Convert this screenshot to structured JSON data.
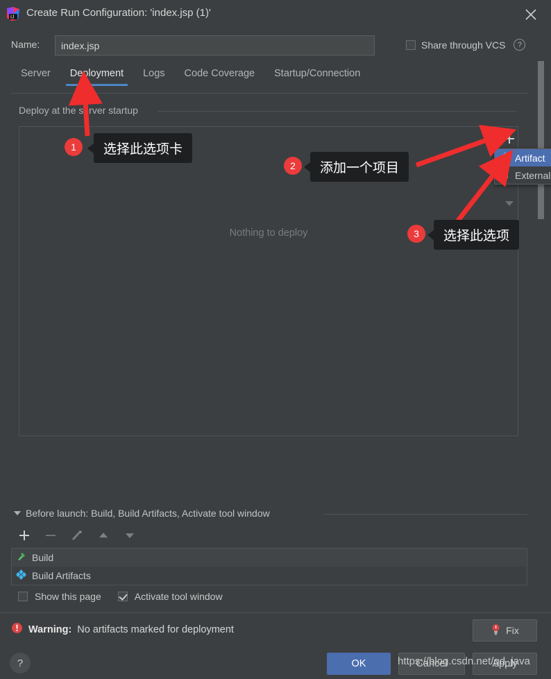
{
  "window": {
    "title": "Create Run Configuration: 'index.jsp (1)'",
    "app_icon": "intellij-idea-logo",
    "close_icon": "close-icon"
  },
  "name_row": {
    "label": "Name:",
    "value": "index.jsp",
    "placeholder": "",
    "share_vcs_label": "Share through VCS",
    "share_vcs_checked": false,
    "help_icon": "question-mark-icon"
  },
  "tabs": [
    {
      "label": "Server",
      "active": false
    },
    {
      "label": "Deployment",
      "active": true
    },
    {
      "label": "Logs",
      "active": false
    },
    {
      "label": "Code Coverage",
      "active": false
    },
    {
      "label": "Startup/Connection",
      "active": false
    }
  ],
  "deployment": {
    "group_title": "Deploy at the server startup",
    "empty_text": "Nothing to deploy",
    "add_icon": "plus-icon",
    "dropdown_icon": "chevron-down-icon"
  },
  "popup_menu": {
    "items": [
      {
        "label": "Artifact",
        "icon": "artifact-icon",
        "selected": true
      },
      {
        "label": "External",
        "icon": "external-source-icon",
        "selected": false
      }
    ]
  },
  "before_launch": {
    "title": "Before launch: Build, Build Artifacts, Activate tool window",
    "collapse_icon": "triangle-down-icon",
    "toolbar": [
      {
        "name": "add-icon",
        "label": "+"
      },
      {
        "name": "remove-icon",
        "label": "−"
      },
      {
        "name": "edit-pencil-icon",
        "label": ""
      },
      {
        "name": "move-up-icon",
        "label": ""
      },
      {
        "name": "move-down-icon",
        "label": ""
      }
    ],
    "tasks": [
      {
        "label": "Build",
        "icon": "hammer-icon"
      },
      {
        "label": "Build Artifacts",
        "icon": "artifact-icon"
      }
    ],
    "show_page_label": "Show this page",
    "show_page_checked": false,
    "activate_tool_window_label": "Activate tool window",
    "activate_tool_window_checked": true
  },
  "warning": {
    "prefix": "Warning:",
    "message": "No artifacts marked for deployment",
    "icon": "error-exclamation-icon",
    "fix_label": "Fix",
    "fix_icon": "lightbulb-icon"
  },
  "footer": {
    "help_label": "?",
    "ok_label": "OK",
    "cancel_label": "Cancel",
    "apply_label": "Apply"
  },
  "watermark": {
    "text": "https://blog.csdn.net/gd_java"
  },
  "annotations": [
    {
      "number": "1",
      "text": "选择此选项卡"
    },
    {
      "number": "2",
      "text": "添加一个项目"
    },
    {
      "number": "3",
      "text": "选择此选项"
    }
  ],
  "colors": {
    "background": "#3c3f41",
    "accent_blue": "#4b6eaf",
    "tab_underline": "#4a88c7",
    "annotation_red": "#ec3b3b",
    "warning_red": "#db4545"
  }
}
